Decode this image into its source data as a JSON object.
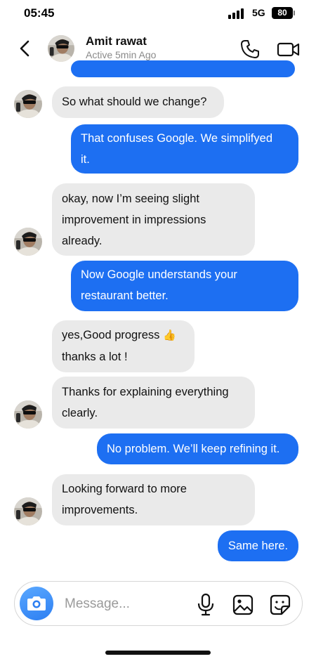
{
  "status_bar": {
    "time": "05:45",
    "network": "5G",
    "battery": "80"
  },
  "header": {
    "contact_name": "Amit rawat",
    "contact_status": "Active 5min Ago"
  },
  "messages": [
    {
      "from": "me",
      "text": ""
    },
    {
      "from": "contact",
      "text": "So what should we change?"
    },
    {
      "from": "me",
      "line1": "That confuses Google. We simplifyed",
      "line2": "it."
    },
    {
      "from": "contact",
      "line1": "okay, now I’m seeing slight",
      "line2": "improvement in impressions",
      "line3": "already."
    },
    {
      "from": "me",
      "line1": "Now Google understands your",
      "line2": "restaurant better."
    },
    {
      "from": "contact",
      "line1": "yes,Good progress",
      "emoji": "👍",
      "line2": "thanks a lot !"
    },
    {
      "from": "contact",
      "line1": "Thanks for explaining everything",
      "line2": "clearly."
    },
    {
      "from": "me",
      "text": "No problem. We’ll keep refining it."
    },
    {
      "from": "contact",
      "line1": "Looking forward to more",
      "line2": "improvements."
    },
    {
      "from": "me",
      "text": "Same here."
    }
  ],
  "composer": {
    "placeholder": "Message..."
  },
  "colors": {
    "outgoing_bubble": "#1d6ff2",
    "incoming_bubble": "#eaeaea",
    "camera_button": "#2d7ff2"
  },
  "icons": {
    "back": "chevron-left-icon",
    "call": "phone-icon",
    "video": "video-camera-icon",
    "camera": "camera-icon",
    "mic": "microphone-icon",
    "gallery": "image-icon",
    "sticker": "sticker-icon"
  }
}
